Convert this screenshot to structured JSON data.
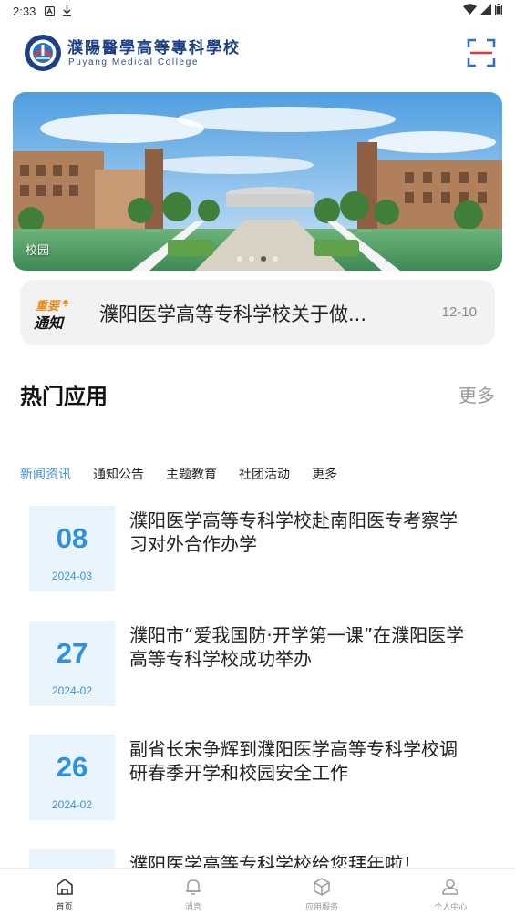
{
  "status_bar": {
    "time": "2:33"
  },
  "header": {
    "school_name_cn": "濮陽醫學高等專科學校",
    "school_name_en": "Puyang Medical College",
    "scan_icon": "scan-icon"
  },
  "banner": {
    "caption": "校园",
    "dots": 4,
    "active_dot": 3
  },
  "notice": {
    "badge_line1": "重要",
    "badge_line2": "通知",
    "text": "濮阳医学高等专科学校关于做...",
    "date": "12-10"
  },
  "hot_apps": {
    "title": "热门应用",
    "more": "更多"
  },
  "tabs": [
    {
      "label": "新闻资讯",
      "active": true
    },
    {
      "label": "通知公告",
      "active": false
    },
    {
      "label": "主题教育",
      "active": false
    },
    {
      "label": "社团活动",
      "active": false
    },
    {
      "label": "更多",
      "active": false
    }
  ],
  "news": [
    {
      "day": "08",
      "ym": "2024-03",
      "title": "濮阳医学高等专科学校赴南阳医专考察学习对外合作办学"
    },
    {
      "day": "27",
      "ym": "2024-02",
      "title": "濮阳市“爱我国防·开学第一课”在濮阳医学高等专科学校成功举办"
    },
    {
      "day": "26",
      "ym": "2024-02",
      "title": "副省长宋争辉到濮阳医学高等专科学校调研春季开学和校园安全工作"
    },
    {
      "day": "",
      "ym": "",
      "title": "濮阳医学高等专科学校给您拜年啦！"
    }
  ],
  "bottom_nav": [
    {
      "label": "首页",
      "icon": "home-icon",
      "active": true
    },
    {
      "label": "消息",
      "icon": "bell-icon",
      "active": false
    },
    {
      "label": "应用服务",
      "icon": "cube-icon",
      "active": false
    },
    {
      "label": "个人中心",
      "icon": "user-icon",
      "active": false
    }
  ],
  "colors": {
    "accent": "#3f94d9",
    "brand": "#1d3f86",
    "date_bg": "#e9f4fc",
    "notice_bg": "#f2f2f2"
  }
}
